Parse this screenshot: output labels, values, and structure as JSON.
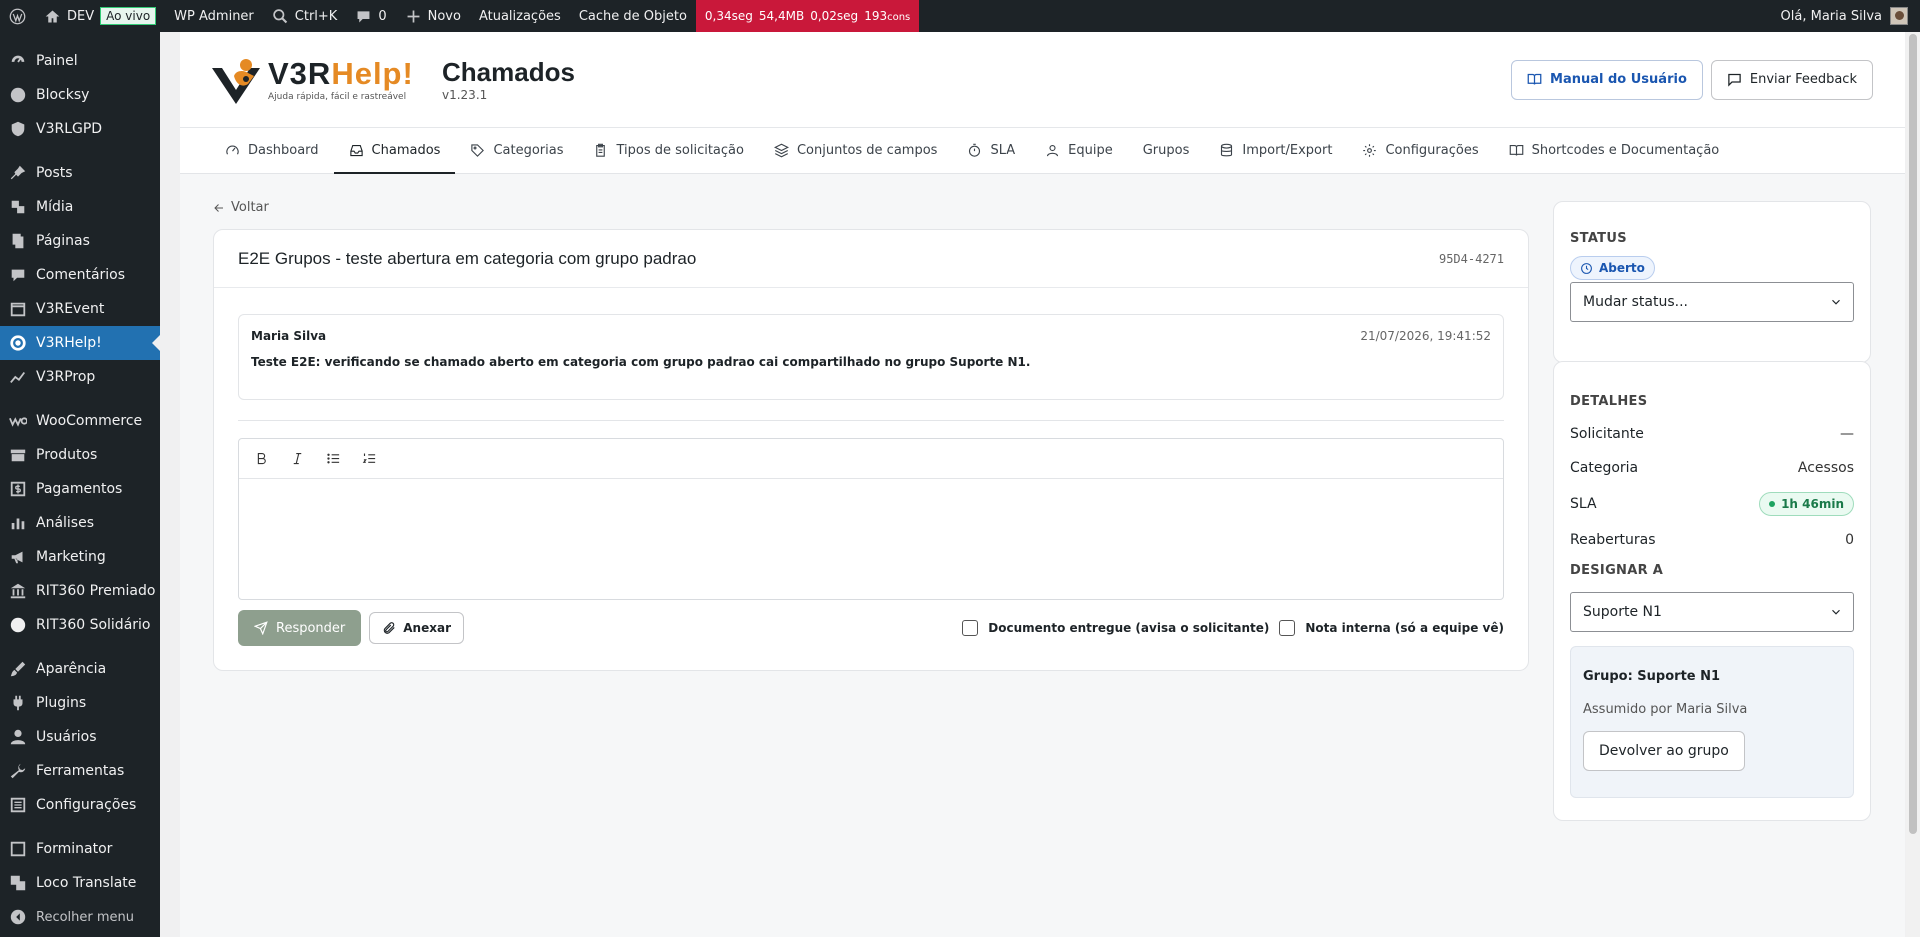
{
  "adminbar": {
    "site": "DEV",
    "live": "Ao vivo",
    "wp_adminer": "WP Adminer",
    "search": "Ctrl+K",
    "comments": "0",
    "new": "Novo",
    "updates": "Atualizações",
    "cache": "Cache de Objeto",
    "qm": {
      "time": "0,34seg",
      "mem": "54,4MB",
      "db": "0,02seg",
      "queries": "193",
      "queries_unit": "cons"
    },
    "greeting": "Olá, Maria Silva"
  },
  "sidebar": {
    "items": [
      {
        "label": "Painel",
        "icon": "gauge-icon"
      },
      {
        "label": "Blocksy",
        "icon": "blocksy-icon"
      },
      {
        "label": "V3RLGPD",
        "icon": "shield-icon"
      },
      {
        "label": "Posts",
        "icon": "pin-icon"
      },
      {
        "label": "Mídia",
        "icon": "media-icon"
      },
      {
        "label": "Páginas",
        "icon": "pages-icon"
      },
      {
        "label": "Comentários",
        "icon": "comment-icon"
      },
      {
        "label": "V3REvent",
        "icon": "calendar-icon"
      },
      {
        "label": "V3RHelp!",
        "icon": "lifebuoy-icon"
      },
      {
        "label": "V3RProp",
        "icon": "chart-icon"
      },
      {
        "label": "WooCommerce",
        "icon": "woo-icon"
      },
      {
        "label": "Produtos",
        "icon": "archive-icon"
      },
      {
        "label": "Pagamentos",
        "icon": "dollar-icon"
      },
      {
        "label": "Análises",
        "icon": "bar-chart-icon"
      },
      {
        "label": "Marketing",
        "icon": "megaphone-icon"
      },
      {
        "label": "RIT360 Premiado",
        "icon": "bank-icon"
      },
      {
        "label": "RIT360 Solidário",
        "icon": "circle-icon"
      },
      {
        "label": "Aparência",
        "icon": "brush-icon"
      },
      {
        "label": "Plugins",
        "icon": "plugin-icon"
      },
      {
        "label": "Usuários",
        "icon": "user-icon"
      },
      {
        "label": "Ferramentas",
        "icon": "wrench-icon"
      },
      {
        "label": "Configurações",
        "icon": "settings-icon"
      },
      {
        "label": "Forminator",
        "icon": "forminator-icon"
      },
      {
        "label": "Loco Translate",
        "icon": "translate-icon"
      }
    ],
    "collapse": "Recolher menu"
  },
  "header": {
    "logo_brand_1": "V3R",
    "logo_brand_2": "Help!",
    "logo_tagline": "Ajuda rápida, fácil e rastreável",
    "title": "Chamados",
    "version": "v1.23.1",
    "manual": "Manual do Usuário",
    "feedback": "Enviar Feedback"
  },
  "tabs": [
    {
      "label": "Dashboard",
      "icon": "gauge-icon"
    },
    {
      "label": "Chamados",
      "icon": "inbox-icon"
    },
    {
      "label": "Categorias",
      "icon": "tag-icon"
    },
    {
      "label": "Tipos de solicitação",
      "icon": "clipboard-icon"
    },
    {
      "label": "Conjuntos de campos",
      "icon": "layers-icon"
    },
    {
      "label": "SLA",
      "icon": "timer-icon"
    },
    {
      "label": "Equipe",
      "icon": "users-icon"
    },
    {
      "label": "Grupos",
      "icon": ""
    },
    {
      "label": "Import/Export",
      "icon": "database-icon"
    },
    {
      "label": "Configurações",
      "icon": "gear-icon"
    },
    {
      "label": "Shortcodes e Documentação",
      "icon": "book-icon"
    }
  ],
  "back": "Voltar",
  "ticket": {
    "title": "E2E Grupos - teste abertura em categoria com grupo padrao",
    "id": "95D4-4271",
    "message": {
      "author": "Maria Silva",
      "date": "21/07/2026, 19:41:52",
      "body": "Teste E2E: verificando se chamado aberto em categoria com grupo padrao cai compartilhado no grupo Suporte N1."
    },
    "reply_label": "Responder",
    "attach_label": "Anexar",
    "check_document": "Documento entregue (avisa o solicitante)",
    "check_internal": "Nota interna (só a equipe vê)"
  },
  "status": {
    "title": "STATUS",
    "badge": "Aberto",
    "select": "Mudar status..."
  },
  "details": {
    "title": "DETALHES",
    "requester_label": "Solicitante",
    "requester_value": "—",
    "category_label": "Categoria",
    "category_value": "Acessos",
    "sla_label": "SLA",
    "sla_value": "1h 46min",
    "reopens_label": "Reaberturas",
    "reopens_value": "0",
    "assign_title": "DESIGNAR A",
    "assign_select": "Suporte N1",
    "group_name": "Grupo: Suporte N1",
    "group_by": "Assumido por Maria Silva",
    "return_button": "Devolver ao grupo"
  },
  "colors": {
    "admin_bg": "#1d2327",
    "active_menu": "#2271b1",
    "brand_orange": "#e58a24",
    "qm_red": "#c9183a",
    "reply_button": "#8e9f8e"
  }
}
